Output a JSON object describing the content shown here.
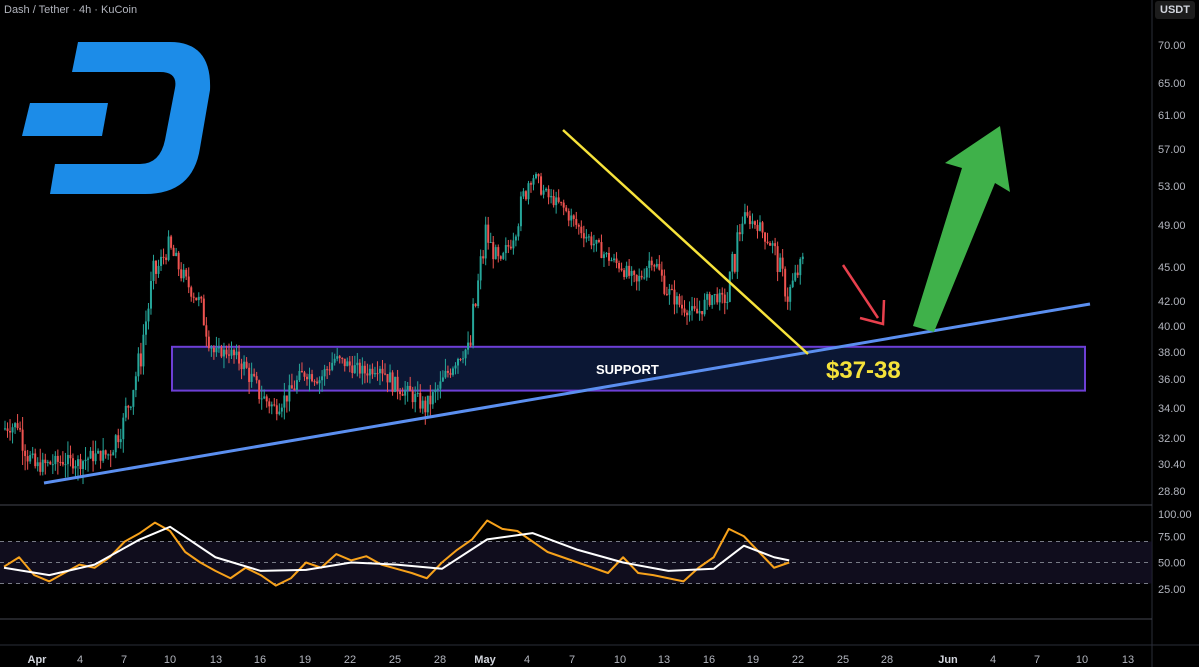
{
  "header": {
    "title": "Dash / Tether · 4h · KuCoin",
    "unit": "USDT"
  },
  "chart_data": {
    "type": "candlestick",
    "price_axis": {
      "ticks": [
        "70.00",
        "65.00",
        "61.00",
        "57.00",
        "53.00",
        "49.00",
        "45.00",
        "42.00",
        "40.00",
        "38.00",
        "36.00",
        "34.00",
        "32.00",
        "30.40",
        "28.80"
      ]
    },
    "time_axis": {
      "ticks": [
        "Apr",
        "4",
        "7",
        "10",
        "13",
        "16",
        "19",
        "22",
        "25",
        "28",
        "May",
        "4",
        "7",
        "10",
        "13",
        "16",
        "19",
        "22",
        "25",
        "28",
        "Jun",
        "4",
        "7",
        "10",
        "13"
      ],
      "bold_ticks": [
        "Apr",
        "May",
        "Jun"
      ]
    },
    "close_path": [
      [
        "Apr 1",
        32.6
      ],
      [
        "Apr 2",
        32.9
      ],
      [
        "Apr 3",
        30.2
      ],
      [
        "Apr 4",
        30.4
      ],
      [
        "Apr 5",
        30.6
      ],
      [
        "Apr 6",
        30.5
      ],
      [
        "Apr 7",
        30.9
      ],
      [
        "Apr 8",
        31.0
      ],
      [
        "Apr 9",
        33.0
      ],
      [
        "Apr 10",
        37.0
      ],
      [
        "Apr 11",
        44.0
      ],
      [
        "Apr 12",
        47.0
      ],
      [
        "Apr 13",
        44.0
      ],
      [
        "Apr 14",
        42.0
      ],
      [
        "Apr 15",
        38.0
      ],
      [
        "Apr 16",
        38.0
      ],
      [
        "Apr 17",
        37.0
      ],
      [
        "Apr 18",
        35.0
      ],
      [
        "Apr 19",
        34.0
      ],
      [
        "Apr 20",
        35.0
      ],
      [
        "Apr 21",
        36.5
      ],
      [
        "Apr 22",
        36.0
      ],
      [
        "Apr 23",
        37.5
      ],
      [
        "Apr 24",
        37.0
      ],
      [
        "Apr 25",
        36.5
      ],
      [
        "Apr 26",
        37.0
      ],
      [
        "Apr 27",
        35.5
      ],
      [
        "Apr 28",
        35.0
      ],
      [
        "Apr 29",
        34.0
      ],
      [
        "Apr 30",
        35.5
      ],
      [
        "May 1",
        37.5
      ],
      [
        "May 2",
        38.5
      ],
      [
        "May 3",
        48.0
      ],
      [
        "May 4",
        45.0
      ],
      [
        "May 5",
        49.0
      ],
      [
        "May 6",
        54.5
      ],
      [
        "May 7",
        52.0
      ],
      [
        "May 8",
        51.0
      ],
      [
        "May 9",
        49.0
      ],
      [
        "May 10",
        47.5
      ],
      [
        "May 11",
        46.0
      ],
      [
        "May 12",
        45.0
      ],
      [
        "May 13",
        43.5
      ],
      [
        "May 14",
        46.0
      ],
      [
        "May 15",
        43.0
      ],
      [
        "May 16",
        41.5
      ],
      [
        "May 17",
        41.0
      ],
      [
        "May 18",
        42.5
      ],
      [
        "May 19",
        42.0
      ],
      [
        "May 20",
        50.0
      ],
      [
        "May 21",
        49.0
      ],
      [
        "May 22",
        47.0
      ],
      [
        "May 23",
        42.5
      ],
      [
        "May 24",
        45.5
      ]
    ],
    "rsi": {
      "ticks": [
        "100.00",
        "75.00",
        "50.00",
        "25.00"
      ],
      "levels": [
        70,
        50,
        30
      ],
      "series": [
        {
          "role": "rsi",
          "values": [
            [
              1,
              46
            ],
            [
              2,
              55
            ],
            [
              3,
              38
            ],
            [
              4,
              32
            ],
            [
              5,
              40
            ],
            [
              6,
              48
            ],
            [
              7,
              45
            ],
            [
              8,
              55
            ],
            [
              9,
              70
            ],
            [
              10,
              78
            ],
            [
              11,
              88
            ],
            [
              12,
              80
            ],
            [
              13,
              60
            ],
            [
              14,
              50
            ],
            [
              15,
              42
            ],
            [
              16,
              35
            ],
            [
              17,
              45
            ],
            [
              18,
              38
            ],
            [
              19,
              28
            ],
            [
              20,
              35
            ],
            [
              21,
              50
            ],
            [
              22,
              45
            ],
            [
              23,
              58
            ],
            [
              24,
              52
            ],
            [
              25,
              56
            ],
            [
              26,
              48
            ],
            [
              27,
              44
            ],
            [
              28,
              40
            ],
            [
              29,
              35
            ],
            [
              30,
              50
            ],
            [
              31,
              62
            ],
            [
              32,
              72
            ],
            [
              33,
              90
            ],
            [
              34,
              82
            ],
            [
              35,
              80
            ],
            [
              36,
              70
            ],
            [
              37,
              60
            ],
            [
              38,
              55
            ],
            [
              39,
              50
            ],
            [
              40,
              45
            ],
            [
              41,
              40
            ],
            [
              42,
              55
            ],
            [
              43,
              40
            ],
            [
              44,
              38
            ],
            [
              45,
              35
            ],
            [
              46,
              32
            ],
            [
              47,
              45
            ],
            [
              48,
              55
            ],
            [
              49,
              82
            ],
            [
              50,
              75
            ],
            [
              51,
              60
            ],
            [
              52,
              45
            ],
            [
              53,
              50
            ]
          ]
        },
        {
          "role": "signal",
          "values": [
            [
              1,
              45
            ],
            [
              4,
              38
            ],
            [
              7,
              48
            ],
            [
              10,
              72
            ],
            [
              12,
              84
            ],
            [
              15,
              55
            ],
            [
              18,
              42
            ],
            [
              21,
              43
            ],
            [
              24,
              50
            ],
            [
              27,
              48
            ],
            [
              30,
              44
            ],
            [
              33,
              72
            ],
            [
              36,
              78
            ],
            [
              39,
              62
            ],
            [
              42,
              50
            ],
            [
              45,
              42
            ],
            [
              48,
              44
            ],
            [
              50,
              66
            ],
            [
              52,
              55
            ],
            [
              53,
              52
            ]
          ]
        }
      ]
    },
    "annotations": {
      "support_label": "SUPPORT",
      "price_label": "$37-38"
    },
    "colors": {
      "up": "#26a69a",
      "down": "#ef5350",
      "support_zone_fill": "#0d1b3d",
      "support_zone_border": "#6d3fd6",
      "trendline": "#5b8ff0",
      "resistance_line": "#f7e33b",
      "arrow_up": "#3fb14a",
      "arrow_down": "#e8404d",
      "price_label": "#f5e23a",
      "rsi_line": "#f7a21b",
      "rsi_signal": "#ffffff",
      "logo": "#1c8ce8"
    },
    "logo_icon": "dash-logo-icon"
  }
}
